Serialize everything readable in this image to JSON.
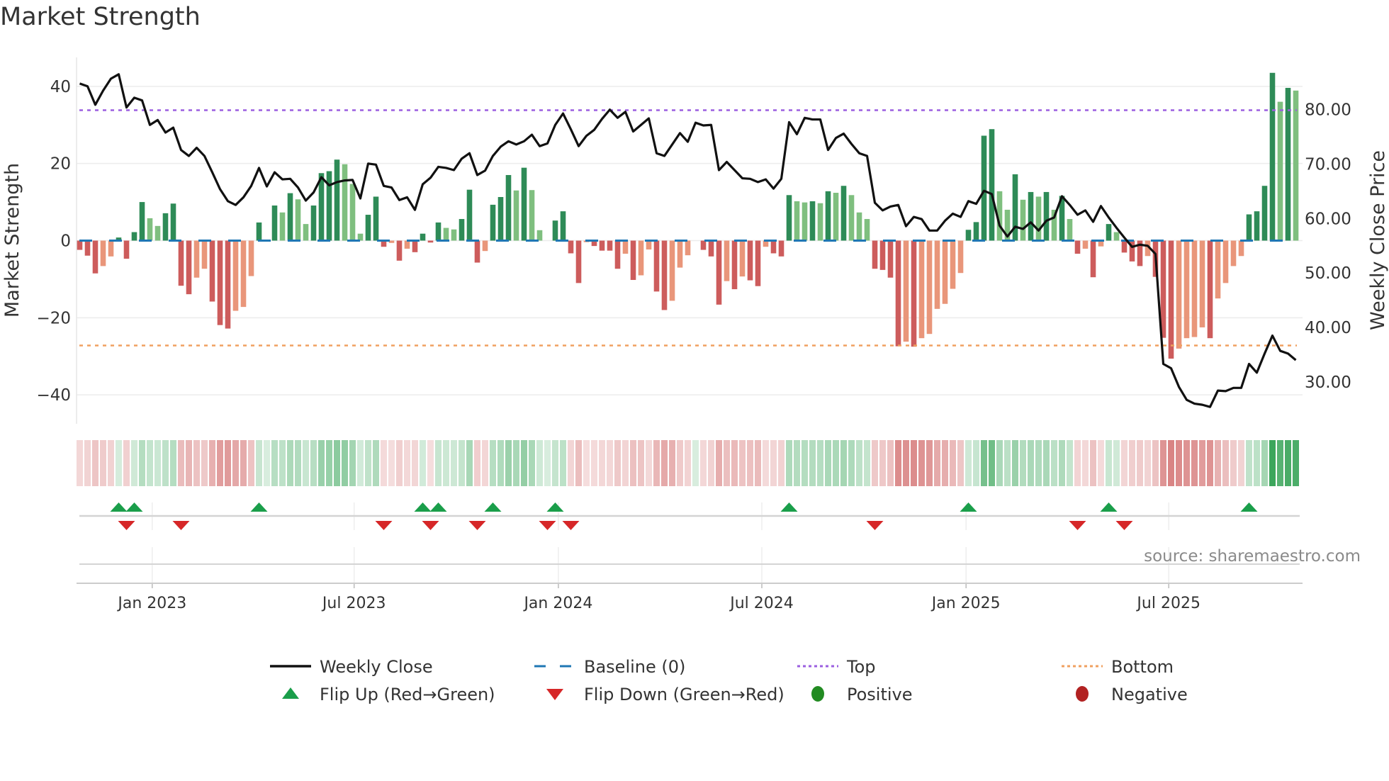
{
  "title": "Market Strength",
  "source": "source: sharemaestro.com",
  "colors": {
    "pos_up": "#2e8b57",
    "pos_down": "#7fbf7f",
    "neg_down": "#cd5c5c",
    "neg_up": "#e9967a",
    "baseline": "#1f77b4",
    "top": "#9b5fe0",
    "bottom": "#f0a060",
    "close": "#111111",
    "flip_up": "#1a9e4a",
    "flip_down": "#d62728",
    "positive": "#228b22",
    "negative": "#b22222",
    "heat_green": "#3aa55a",
    "heat_red": "#cd5c5c"
  },
  "chart_data": {
    "type": "bar",
    "title": "Market Strength",
    "ylabel": "Market Strength",
    "y2label": "Weekly Close Price",
    "ylim": [
      -47.5,
      47.5
    ],
    "y2lim": [
      22.3,
      89.6
    ],
    "yticks": [
      {
        "v": 40,
        "label": "40"
      },
      {
        "v": 20,
        "label": "20"
      },
      {
        "v": 0,
        "label": "0"
      },
      {
        "v": -20,
        "label": "−20"
      },
      {
        "v": -40,
        "label": "−40"
      }
    ],
    "y2ticks": [
      {
        "v": 80,
        "label": "80.00"
      },
      {
        "v": 70,
        "label": "70.00"
      },
      {
        "v": 60,
        "label": "60.00"
      },
      {
        "v": 50,
        "label": "50.00"
      },
      {
        "v": 40,
        "label": "40.00"
      },
      {
        "v": 30,
        "label": "30.00"
      }
    ],
    "xticks": [
      {
        "week": 9.3,
        "label": "Jan 2023"
      },
      {
        "week": 35.2,
        "label": "Jul 2023"
      },
      {
        "week": 61.4,
        "label": "Jan 2024"
      },
      {
        "week": 87.5,
        "label": "Jul 2024"
      },
      {
        "week": 113.7,
        "label": "Jan 2025"
      },
      {
        "week": 139.7,
        "label": "Jul 2025"
      }
    ],
    "top_level": 33.8,
    "bottom_level": -27.2,
    "baseline": 0,
    "strength": [
      -2.4,
      -3.9,
      -8.5,
      -6.6,
      -4.1,
      0.8,
      -4.7,
      2.2,
      10,
      5.8,
      3.8,
      7.1,
      9.6,
      -11.7,
      -13.9,
      -9.6,
      -7.3,
      -15.8,
      -21.9,
      -22.8,
      -18.2,
      -17.2,
      -9.2,
      4.7,
      0,
      9.1,
      7.3,
      12.3,
      10.7,
      4.3,
      9.1,
      17.5,
      18,
      21,
      19.8,
      14.7,
      1.8,
      6.7,
      11.4,
      -1.6,
      -0.6,
      -5.2,
      -2.1,
      -3,
      1.8,
      -0.5,
      4.7,
      3.3,
      2.9,
      5.6,
      13.2,
      -5.7,
      -2.7,
      9.3,
      11.3,
      17,
      13,
      18.9,
      13.1,
      2.7,
      0,
      5.2,
      7.6,
      -3.3,
      -11,
      -0.4,
      -1.4,
      -2.6,
      -2.6,
      -7.3,
      -3.4,
      -10.2,
      -9,
      -2.3,
      -13.2,
      -18,
      -15.6,
      -7,
      -3.8,
      0,
      -2.4,
      -4.1,
      -16.6,
      -10.5,
      -12.6,
      -9.3,
      -10.3,
      -11.8,
      -1.6,
      -3.3,
      -4.1,
      11.8,
      10.2,
      9.9,
      10.2,
      9.7,
      12.8,
      12.4,
      14.2,
      11.8,
      7.3,
      5.6,
      -7.3,
      -7.6,
      -9.6,
      -27.4,
      -26.2,
      -27.5,
      -25.3,
      -24.2,
      -17.7,
      -16.4,
      -12.5,
      -8.4,
      2.8,
      4.8,
      27.2,
      28.9,
      12.8,
      8,
      17.2,
      10.6,
      12.6,
      11.4,
      12.6,
      8,
      11.6,
      5.6,
      -3.4,
      -2.1,
      -9.5,
      -1.5,
      4.3,
      2.2,
      -3.1,
      -5.4,
      -6.6,
      -4,
      -9.4,
      -25.2,
      -30.6,
      -28,
      -25.3,
      -25,
      -22.5,
      -25.3,
      -15,
      -11,
      -6.6,
      -4,
      6.8,
      7.6,
      14.2,
      43.5,
      36,
      39.6,
      38.9
    ],
    "close": [
      84.8,
      84.3,
      80.9,
      83.5,
      85.7,
      86.5,
      80.4,
      82.2,
      81.7,
      77.2,
      78.1,
      75.8,
      76.7,
      72.6,
      71.5,
      73,
      71.5,
      68.5,
      65.4,
      63.2,
      62.5,
      63.9,
      66,
      69.3,
      65.9,
      68.5,
      67.2,
      67.3,
      65.7,
      63.3,
      64.8,
      67.6,
      66.1,
      66.7,
      67,
      67.1,
      63.7,
      70.1,
      69.9,
      66,
      65.7,
      63.4,
      63.9,
      61.6,
      66.3,
      67.5,
      69.5,
      69.3,
      68.9,
      71,
      72,
      68,
      68.8,
      71.5,
      73.2,
      74.2,
      73.6,
      74.2,
      75.4,
      73.3,
      73.8,
      77.2,
      79.3,
      76.4,
      73.3,
      75.2,
      76.3,
      78.3,
      80,
      78.5,
      79.6,
      76,
      77.2,
      78.4,
      72,
      71.5,
      73.6,
      75.7,
      74.1,
      77.6,
      77.1,
      77.2,
      68.9,
      70.4,
      68.9,
      67.4,
      67.3,
      66.7,
      67.2,
      65.5,
      67.3,
      77.7,
      75.5,
      78.5,
      78.2,
      78.2,
      72.6,
      74.8,
      75.6,
      73.7,
      72,
      71.5,
      62.9,
      61.5,
      62.2,
      62.5,
      58.6,
      60.3,
      59.9,
      57.8,
      57.8,
      59.6,
      60.9,
      60.3,
      63.2,
      62.7,
      65.1,
      64.5,
      58.7,
      56.7,
      58.5,
      58.1,
      59.3,
      57.8,
      59.6,
      60.2,
      64.1,
      62.5,
      60.7,
      61.5,
      59.4,
      62.3,
      60.2,
      58.3,
      56.5,
      54.8,
      55.2,
      55,
      53.5,
      33.3,
      32.5,
      29.1,
      26.7,
      26,
      25.8,
      25.4,
      28.4,
      28.3,
      28.9,
      28.9,
      33.3,
      31.7,
      35.2,
      38.5,
      35.7,
      35.2,
      34
    ],
    "flip_up_weeks": [
      5,
      7,
      23,
      44,
      46,
      53,
      61,
      91,
      114,
      132,
      150
    ],
    "flip_down_weeks": [
      6,
      13,
      39,
      45,
      51,
      60,
      63,
      102,
      128,
      134
    ],
    "legend_placement": "bottom-center",
    "legend": [
      {
        "key": "close",
        "label": "Weekly Close"
      },
      {
        "key": "baseline",
        "label": "Baseline (0)"
      },
      {
        "key": "top",
        "label": "Top"
      },
      {
        "key": "bottom",
        "label": "Bottom"
      },
      {
        "key": "flip_up",
        "label": "Flip Up (Red→Green)"
      },
      {
        "key": "flip_down",
        "label": "Flip Down (Green→Red)"
      },
      {
        "key": "positive",
        "label": "Positive"
      },
      {
        "key": "negative",
        "label": "Negative"
      }
    ]
  }
}
